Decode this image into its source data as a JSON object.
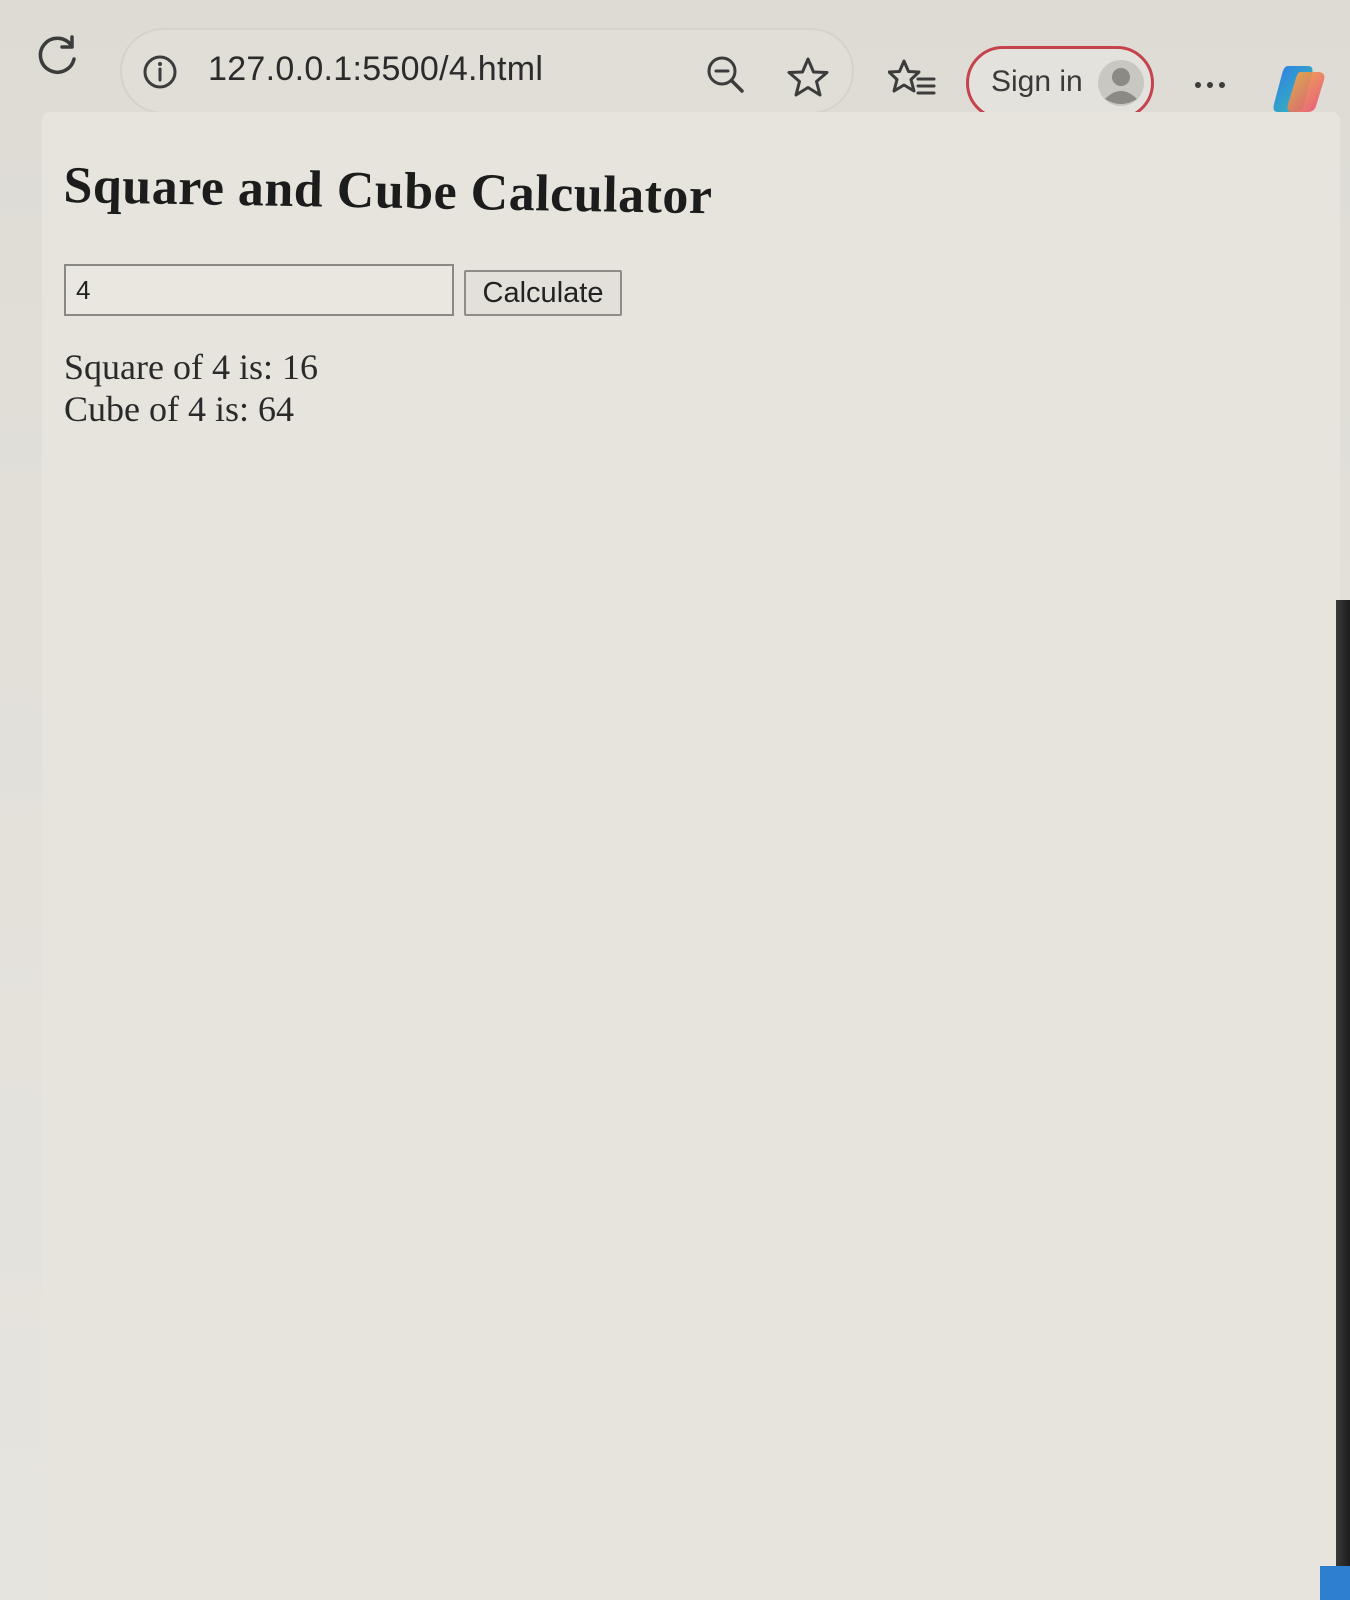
{
  "browser": {
    "url": "127.0.0.1:5500/4.html",
    "signin_label": "Sign in",
    "icons": {
      "reload": "reload-icon",
      "site_info": "info-icon",
      "zoom": "zoom-out-icon",
      "favorite": "star-icon",
      "favorites": "favorites-list-icon",
      "profile": "avatar-icon",
      "more": "more-icon",
      "copilot": "copilot-icon"
    },
    "colors": {
      "signin_border": "#c6434e"
    }
  },
  "page": {
    "title": "Square and Cube Calculator",
    "input_value": "4",
    "button_label": "Calculate",
    "square_result": "Square of 4 is: 16",
    "cube_result": "Cube of 4 is: 64"
  }
}
